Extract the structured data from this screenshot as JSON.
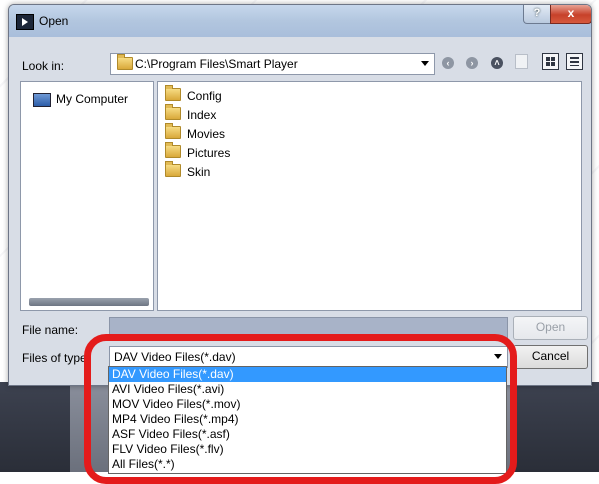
{
  "window": {
    "title": "Open",
    "help_label": "?",
    "close_label": "x"
  },
  "look_in": {
    "label": "Look in:",
    "path": "C:\\Program Files\\Smart Player"
  },
  "places": {
    "items": [
      {
        "label": "My Computer"
      }
    ]
  },
  "files": [
    {
      "name": "Config"
    },
    {
      "name": "Index"
    },
    {
      "name": "Movies"
    },
    {
      "name": "Pictures"
    },
    {
      "name": "Skin"
    }
  ],
  "file_name": {
    "label": "File name:",
    "value": ""
  },
  "files_of_type": {
    "label": "Files of type:",
    "selected": "DAV Video Files(*.dav)",
    "options": [
      "DAV Video Files(*.dav)",
      "AVI Video Files(*.avi)",
      "MOV Video Files(*.mov)",
      "MP4 Video Files(*.mp4)",
      "ASF Video Files(*.asf)",
      "FLV Video Files(*.flv)",
      "All Files(*.*)"
    ]
  },
  "buttons": {
    "open": "Open",
    "cancel": "Cancel"
  },
  "colors": {
    "highlight": "#e41b1b",
    "selection": "#3399ff",
    "close": "#c7412a"
  },
  "icons": [
    "player-icon",
    "folder-icon",
    "back-icon",
    "forward-icon",
    "up-icon",
    "new-folder-icon",
    "details-view-icon",
    "list-view-icon",
    "computer-icon"
  ]
}
